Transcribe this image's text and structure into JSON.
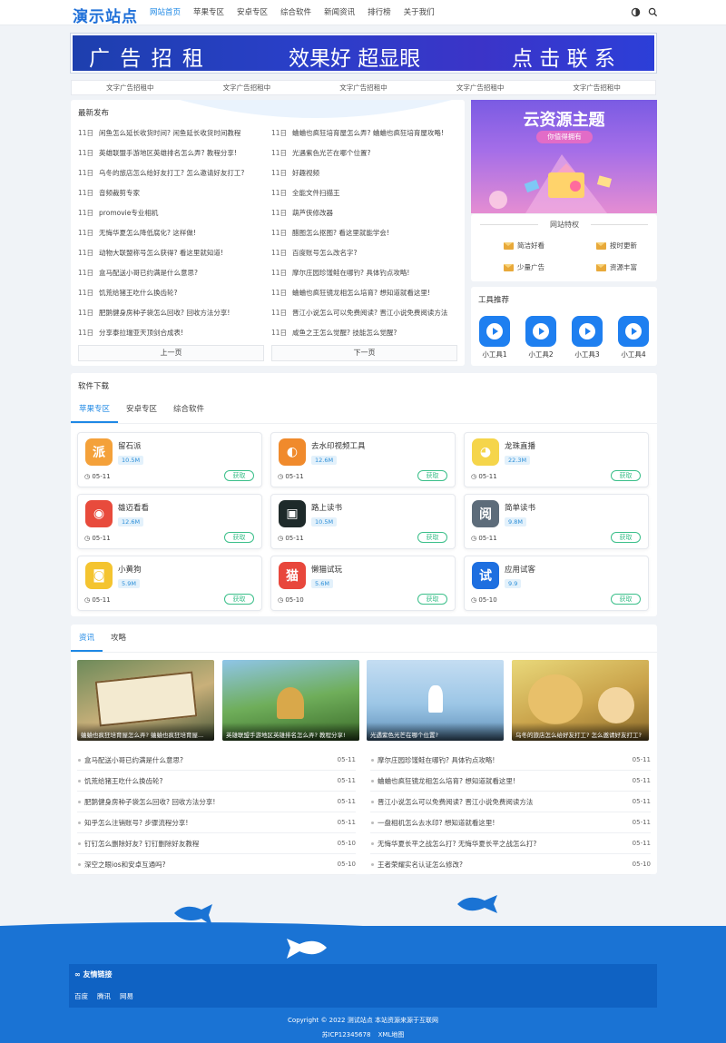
{
  "site": {
    "logo": "演示站点"
  },
  "nav": [
    {
      "label": "网站首页",
      "active": true
    },
    {
      "label": "苹果专区"
    },
    {
      "label": "安卓专区"
    },
    {
      "label": "综合软件"
    },
    {
      "label": "新闻资讯"
    },
    {
      "label": "排行榜"
    },
    {
      "label": "关于我们"
    }
  ],
  "header_icons": [
    "theme-toggle-icon",
    "search-icon"
  ],
  "banner": {
    "parts": [
      "广 告 招 租",
      "效果好 超显眼",
      "点 击 联 系"
    ]
  },
  "text_ads": [
    "文字广告招租中",
    "文字广告招租中",
    "文字广告招租中",
    "文字广告招租中",
    "文字广告招租中"
  ],
  "latest": {
    "title": "最新发布",
    "left": [
      {
        "date": "11日",
        "text": "闲鱼怎么延长收货时间? 闲鱼延长收货时间教程"
      },
      {
        "date": "11日",
        "text": "英雄联盟手游地区英雄排名怎么弄? 教程分享!"
      },
      {
        "date": "11日",
        "text": "乌冬的旅店怎么给好友打工? 怎么邀请好友打工?"
      },
      {
        "date": "11日",
        "text": "音频裁剪专家"
      },
      {
        "date": "11日",
        "text": "promovie专业相机"
      },
      {
        "date": "11日",
        "text": "无悔华夏怎么降低腐化? 这样做!"
      },
      {
        "date": "11日",
        "text": "动物大联盟称号怎么获得? 看这里就知道!"
      },
      {
        "date": "11日",
        "text": "盒马配送小哥已约满是什么意思?"
      },
      {
        "date": "11日",
        "text": "饥荒给猪王吃什么换齿轮?"
      },
      {
        "date": "11日",
        "text": "肥鹅健身房种子袋怎么回收? 回收方法分享!"
      },
      {
        "date": "11日",
        "text": "分享泰拉瑞亚天顶剑合成表!"
      }
    ],
    "right": [
      {
        "date": "11日",
        "text": "蛐蛐也疯狂培育屋怎么弄? 蛐蛐也疯狂培育屋攻略!"
      },
      {
        "date": "11日",
        "text": "光遇紫色光芒在哪个位置?"
      },
      {
        "date": "11日",
        "text": "好趣视频"
      },
      {
        "date": "11日",
        "text": "全能文件扫描王"
      },
      {
        "date": "11日",
        "text": "葫芦侠修改器"
      },
      {
        "date": "11日",
        "text": "醋图怎么抠图? 看这里就能学会!"
      },
      {
        "date": "11日",
        "text": "百度账号怎么改名字?"
      },
      {
        "date": "11日",
        "text": "摩尔庄园珍馐鲑在哪钓? 具体钓点攻略!"
      },
      {
        "date": "11日",
        "text": "蛐蛐也疯狂镜龙相怎么培育? 想知道就看这里!"
      },
      {
        "date": "11日",
        "text": "晋江小说怎么可以免费阅读? 晋江小说免费阅读方法"
      },
      {
        "date": "11日",
        "text": "咸鱼之王怎么觉醒? 技能怎么觉醒?"
      }
    ],
    "prev": "上一页",
    "next": "下一页"
  },
  "side_ad": {
    "title": "云资源主题",
    "subtitle": "你值得拥有"
  },
  "privileges": {
    "title": "网站特权",
    "items": [
      "简洁好看",
      "按时更新",
      "少量广告",
      "资源丰富"
    ]
  },
  "tools": {
    "title": "工具推荐",
    "items": [
      "小工具1",
      "小工具2",
      "小工具3",
      "小工具4"
    ]
  },
  "software": {
    "title": "软件下载",
    "tabs": [
      "苹果专区",
      "安卓专区",
      "综合软件"
    ],
    "action": "获取",
    "cards": [
      {
        "name": "留石派",
        "size": "10.5M",
        "date": "05-11",
        "glyph": "派",
        "color": "#f4a13a"
      },
      {
        "name": "去水印视频工具",
        "size": "12.6M",
        "date": "05-11",
        "glyph": "◐",
        "color": "#f08a2c"
      },
      {
        "name": "龙珠直播",
        "size": "22.3M",
        "date": "05-11",
        "glyph": "◕",
        "color": "#f5d54a"
      },
      {
        "name": "雄迈看看",
        "size": "12.6M",
        "date": "05-11",
        "glyph": "◉",
        "color": "#e84b3c"
      },
      {
        "name": "路上读书",
        "size": "10.5M",
        "date": "05-11",
        "glyph": "▣",
        "color": "#1e2a2a"
      },
      {
        "name": "简单读书",
        "size": "9.8M",
        "date": "05-11",
        "glyph": "阅",
        "color": "#5d6c7a"
      },
      {
        "name": "小黄狗",
        "size": "5.9M",
        "date": "05-11",
        "glyph": "◙",
        "color": "#f4c430"
      },
      {
        "name": "懒猫试玩",
        "size": "5.6M",
        "date": "05-10",
        "glyph": "猫",
        "color": "#e8473c"
      },
      {
        "name": "应用试客",
        "size": "9.9",
        "date": "05-10",
        "glyph": "试",
        "color": "#1e6fe0"
      }
    ]
  },
  "news": {
    "tabs": [
      "资讯",
      "攻略"
    ],
    "thumbs": [
      {
        "caption": "蛐蛐也疯狂培育屋怎么弄? 蛐蛐也疯狂培育屋..."
      },
      {
        "caption": "英雄联盟手游地区英雄排名怎么弄? 教程分享!"
      },
      {
        "caption": "光遇紫色光芒在哪个位置?"
      },
      {
        "caption": "乌冬的旅店怎么给好友打工? 怎么邀请好友打工?"
      }
    ],
    "left": [
      {
        "text": "盒马配送小哥已约满是什么意思?",
        "date": "05-11"
      },
      {
        "text": "饥荒给猪王吃什么换齿轮?",
        "date": "05-11"
      },
      {
        "text": "肥鹅健身房种子袋怎么回收? 回收方法分享!",
        "date": "05-11"
      },
      {
        "text": "知乎怎么注销账号? 步骤流程分享!",
        "date": "05-11"
      },
      {
        "text": "钉钉怎么删除好友? 钉钉删除好友教程",
        "date": "05-10"
      },
      {
        "text": "深空之眼ios和安卓互通吗?",
        "date": "05-10"
      }
    ],
    "right": [
      {
        "text": "摩尔庄园珍馐鲑在哪钓? 具体钓点攻略!",
        "date": "05-11"
      },
      {
        "text": "蛐蛐也疯狂镜龙相怎么培育? 想知道就看这里!",
        "date": "05-11"
      },
      {
        "text": "晋江小说怎么可以免费阅读? 晋江小说免费阅读方法",
        "date": "05-11"
      },
      {
        "text": "一盘相机怎么去水印? 想知道就看这里!",
        "date": "05-11"
      },
      {
        "text": "无悔华夏长平之战怎么打? 无悔华夏长平之战怎么打?",
        "date": "05-11"
      },
      {
        "text": "王者荣耀实名认证怎么修改?",
        "date": "05-10"
      }
    ]
  },
  "footer": {
    "links_title": "友情链接",
    "links": [
      "百度",
      "腾讯",
      "网易"
    ],
    "copyright": "Copyright © 2022 测试站点 本站资源来源于互联网",
    "icp": "苏ICP12345678",
    "sitemap": "XML地图"
  }
}
